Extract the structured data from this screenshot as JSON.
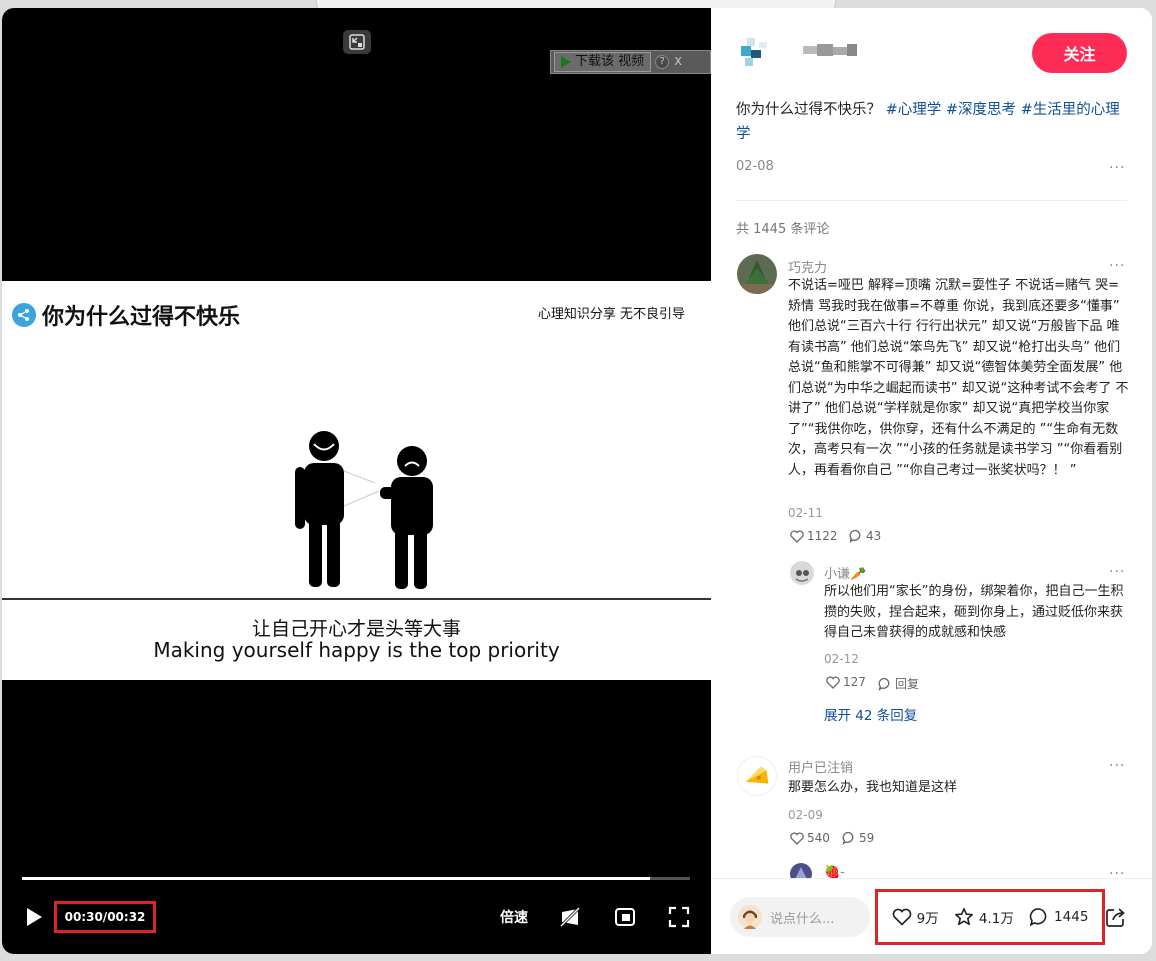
{
  "video": {
    "download_label": "下载该 视频",
    "download_help": "?",
    "download_close": "X",
    "frame_title": "你为什么过得不快乐",
    "frame_tag": "心理知识分享  无不良引导",
    "subtitle_cn": "让自己开心才是头等大事",
    "subtitle_en": "Making yourself happy is the top priority",
    "time": "00:30/00:32",
    "progress": 0.94,
    "speed_label": "倍速"
  },
  "post": {
    "follow_label": "关注",
    "desc_text": "你为什么过得不快乐？",
    "tags": [
      "#心理学",
      "#深度思考",
      "#生活里的心理学"
    ],
    "date": "02-08",
    "more": "···",
    "comment_count": "共 1445 条评论"
  },
  "comments": [
    {
      "name": "巧克力",
      "text": "不说话=哑巴 解释=顶嘴 沉默=耍性子 不说话=赌气 哭=矫情 骂我时我在做事=不尊重 你说，我到底还要多“懂事” 他们总说“三百六十行 行行出状元” 却又说“万般皆下品 唯有读书高” 他们总说“笨鸟先飞” 却又说“枪打出头鸟” 他们总说“鱼和熊掌不可得兼” 却又说“德智体美劳全面发展” 他们总说“为中华之崛起而读书” 却又说“这种考试不会考了 不讲了” 他们总说“学样就是你家” 却又说“真把学校当你家了”“我供你吃，供你穿，还有什么不满足的 ”“生命有无数次，高考只有一次 ”“小孩的任务就是读书学习 ”“你看看别人，再看看你自己 ”“你自己考过一张奖状吗？！ ”",
      "date": "02-11",
      "likes": "1122",
      "replies": "43"
    },
    {
      "name": "小谦🥕",
      "text": "所以他们用“家长”的身份，绑架着你，把自己一生积攒的失败，捏合起来，砸到你身上，通过贬低你来获得自己未曾获得的成就感和快感",
      "date": "02-12",
      "likes": "127",
      "replies": "回复"
    },
    {
      "name": "用户已注销",
      "text": "那要怎么办，我也知道是这样",
      "date": "02-09",
      "likes": "540",
      "replies": "59"
    },
    {
      "name": "🍓-"
    }
  ],
  "expand_label": "展开 42 条回复",
  "bottom": {
    "placeholder": "说点什么...",
    "likes": "9万",
    "favorites": "4.1万",
    "comments": "1445"
  },
  "colors": {
    "accent": "#fe2c55",
    "link": "#0f4e9c",
    "highlight_box": "#e02424"
  },
  "icons": [
    "shrink-icon",
    "share-icon",
    "play-icon",
    "danmaku-off-icon",
    "pip-icon",
    "fullscreen-icon",
    "heart-icon",
    "star-icon",
    "comment-icon",
    "share-arrow-icon"
  ]
}
